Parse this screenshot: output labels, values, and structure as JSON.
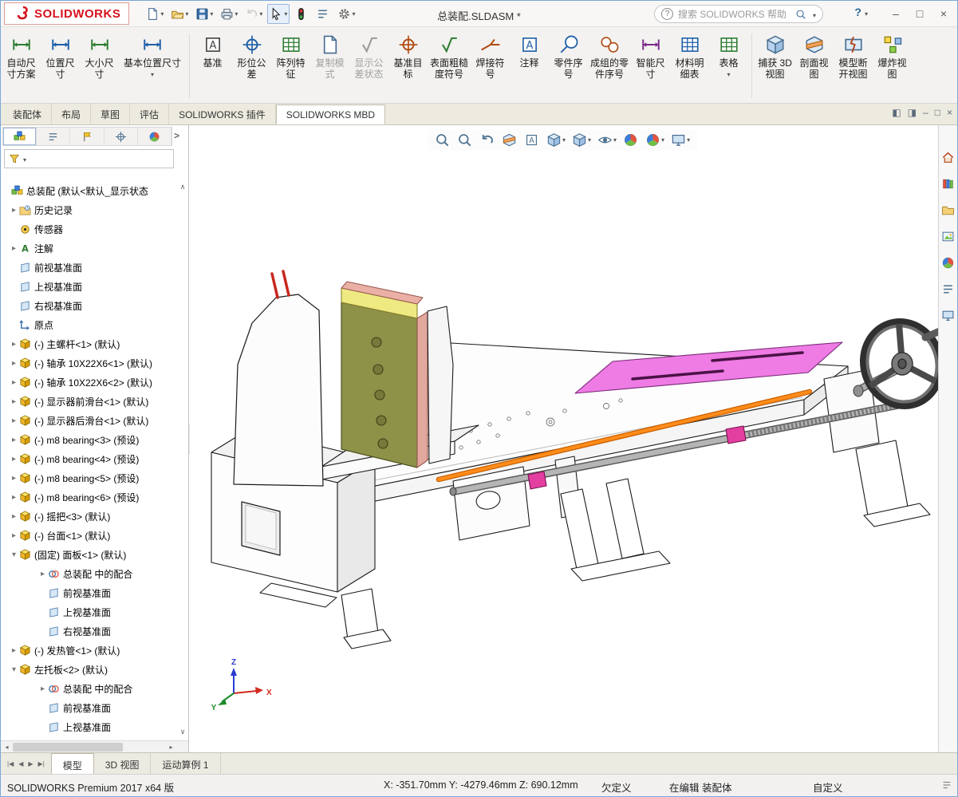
{
  "titlebar": {
    "logo_text": "SOLIDWORKS",
    "document_title": "总装配.SLDASM *",
    "search_placeholder": "搜索 SOLIDWORKS 帮助",
    "help_label": "?",
    "quick_access": [
      {
        "icon": "new-document",
        "dd": "arrow-down"
      },
      {
        "icon": "open",
        "dd": "arrow-down"
      },
      {
        "icon": "save",
        "dd": "arrow-down"
      },
      {
        "icon": "print",
        "dd": "arrow-down"
      },
      {
        "icon": "undo",
        "dd": "arrow-down",
        "disabled": true
      },
      {
        "icon": "select",
        "dd": "arrow-down",
        "pressed": true
      },
      {
        "icon": "rebuild"
      },
      {
        "icon": "file-properties"
      },
      {
        "icon": "options",
        "dd": "arrow-down"
      }
    ],
    "window_controls": [
      {
        "icon": "minimize"
      },
      {
        "icon": "maximize"
      },
      {
        "icon": "close"
      }
    ]
  },
  "ribbon": {
    "items": [
      {
        "icon": "auto-dimension-scheme",
        "label": "自动尺\n寸方案"
      },
      {
        "icon": "location-dimension",
        "label": "位置尺\n寸"
      },
      {
        "icon": "size-dimension",
        "label": "大小尺\n寸"
      },
      {
        "icon": "basic-location-dimension",
        "label": "基本位置尺寸",
        "dd": "arrow-down",
        "wide": true
      },
      {
        "sep": true
      },
      {
        "icon": "datum",
        "label": "基准"
      },
      {
        "icon": "geometric-tolerance",
        "label": "形位公\n差"
      },
      {
        "icon": "pattern-feature",
        "label": "阵列特\n征"
      },
      {
        "icon": "copy-scheme",
        "label": "复制模\n式",
        "disabled": true
      },
      {
        "icon": "tolerance-status",
        "label": "显示公\n差状态",
        "disabled": true
      },
      {
        "icon": "datum-target",
        "label": "基准目\n标"
      },
      {
        "icon": "surface-finish",
        "label": "表面粗糙\n度符号"
      },
      {
        "icon": "weld-symbol",
        "label": "焊接符\n号"
      },
      {
        "icon": "note",
        "label": "注释"
      },
      {
        "icon": "balloon",
        "label": "零件序\n号"
      },
      {
        "icon": "group-balloon",
        "label": "成组的零\n件序号"
      },
      {
        "icon": "smart-dimension",
        "label": "智能尺\n寸"
      },
      {
        "icon": "bom",
        "label": "材料明\n细表"
      },
      {
        "icon": "table",
        "label": "表格",
        "dd": "arrow-down"
      },
      {
        "sep": true
      },
      {
        "icon": "capture-3d-view",
        "label": "捕获 3D\n视图"
      },
      {
        "icon": "section-view",
        "label": "剖面视\n图"
      },
      {
        "icon": "model-break-view",
        "label": "模型断\n开视图"
      },
      {
        "icon": "exploded-view",
        "label": "爆炸视\n图"
      }
    ]
  },
  "cmdtabs": {
    "tabs": [
      {
        "label": "装配体"
      },
      {
        "label": "布局"
      },
      {
        "label": "草图"
      },
      {
        "label": "评估"
      },
      {
        "label": "SOLIDWORKS 插件"
      },
      {
        "label": "SOLIDWORKS MBD",
        "active": true
      }
    ],
    "controls": [
      {
        "icon": "prev-pane"
      },
      {
        "icon": "next-pane"
      },
      {
        "icon": "minimize"
      },
      {
        "icon": "restore"
      },
      {
        "icon": "close"
      }
    ]
  },
  "fmpanel": {
    "tabs": [
      {
        "icon": "featuremanager",
        "active": true
      },
      {
        "icon": "propertymanager"
      },
      {
        "icon": "configurationmanager"
      },
      {
        "icon": "dimxpertmanager"
      },
      {
        "icon": "displaymanager"
      }
    ],
    "tree": [
      {
        "pad": "0px",
        "icon": "assembly",
        "label": "总装配 (默认<默认_显示状态"
      },
      {
        "pad": "10px",
        "arrow": "arrow-right",
        "icon": "history-folder",
        "label": "历史记录"
      },
      {
        "pad": "10px",
        "icon": "sensor",
        "label": "传感器"
      },
      {
        "pad": "10px",
        "arrow": "arrow-right",
        "icon": "annotations",
        "label": "注解"
      },
      {
        "pad": "10px",
        "icon": "plane",
        "label": "前视基准面"
      },
      {
        "pad": "10px",
        "icon": "plane",
        "label": "上视基准面"
      },
      {
        "pad": "10px",
        "icon": "plane",
        "label": "右视基准面"
      },
      {
        "pad": "10px",
        "icon": "origin",
        "label": "原点"
      },
      {
        "pad": "10px",
        "arrow": "arrow-right",
        "icon": "part",
        "label": "(-) 主螺杆<1> (默认)"
      },
      {
        "pad": "10px",
        "arrow": "arrow-right",
        "icon": "part",
        "label": "(-) 轴承 10X22X6<1> (默认)"
      },
      {
        "pad": "10px",
        "arrow": "arrow-right",
        "icon": "part",
        "label": "(-) 轴承 10X22X6<2> (默认)"
      },
      {
        "pad": "10px",
        "arrow": "arrow-right",
        "icon": "part",
        "label": "(-) 显示器前滑台<1> (默认)"
      },
      {
        "pad": "10px",
        "arrow": "arrow-right",
        "icon": "part",
        "label": "(-) 显示器后滑台<1> (默认)"
      },
      {
        "pad": "10px",
        "arrow": "arrow-right",
        "icon": "part",
        "label": "(-) m8 bearing<3> (预设)"
      },
      {
        "pad": "10px",
        "arrow": "arrow-right",
        "icon": "part",
        "label": "(-) m8 bearing<4> (预设)"
      },
      {
        "pad": "10px",
        "arrow": "arrow-right",
        "icon": "part",
        "label": "(-) m8 bearing<5> (预设)"
      },
      {
        "pad": "10px",
        "arrow": "arrow-right",
        "icon": "part",
        "label": "(-) m8 bearing<6> (预设)"
      },
      {
        "pad": "10px",
        "arrow": "arrow-right",
        "icon": "part",
        "label": "(-) 摇把<3> (默认)"
      },
      {
        "pad": "10px",
        "arrow": "arrow-right",
        "icon": "part",
        "label": "(-) 台面<1> (默认)"
      },
      {
        "pad": "10px",
        "arrow": "arrow-down",
        "icon": "part",
        "label": "(固定) 面板<1> (默认)"
      },
      {
        "pad": "46px",
        "arrow": "arrow-right",
        "icon": "mates-folder",
        "label": "总装配 中的配合"
      },
      {
        "pad": "46px",
        "icon": "plane",
        "label": "前视基准面"
      },
      {
        "pad": "46px",
        "icon": "plane",
        "label": "上视基准面"
      },
      {
        "pad": "46px",
        "icon": "plane",
        "label": "右视基准面"
      },
      {
        "pad": "10px",
        "arrow": "arrow-right",
        "icon": "part",
        "label": "(-) 发热管<1> (默认)"
      },
      {
        "pad": "10px",
        "arrow": "arrow-down",
        "icon": "part",
        "label": "左托板<2> (默认)"
      },
      {
        "pad": "46px",
        "arrow": "arrow-right",
        "icon": "mates-folder",
        "label": "总装配 中的配合"
      },
      {
        "pad": "46px",
        "icon": "plane",
        "label": "前视基准面"
      },
      {
        "pad": "46px",
        "icon": "plane",
        "label": "上视基准面"
      }
    ]
  },
  "viewport": {
    "hud": [
      {
        "icon": "zoom-fit"
      },
      {
        "icon": "zoom-area"
      },
      {
        "icon": "previous-view"
      },
      {
        "icon": "section-view-hud"
      },
      {
        "icon": "dynamic-annotation-views"
      },
      {
        "icon": "view-orientation",
        "dd": "arrow-down"
      },
      {
        "icon": "display-style",
        "dd": "arrow-down"
      },
      {
        "icon": "hide-show-items",
        "dd": "arrow-down"
      },
      {
        "icon": "edit-appearance"
      },
      {
        "icon": "apply-scene",
        "dd": "arrow-down"
      },
      {
        "icon": "view-settings",
        "dd": "arrow-down"
      }
    ],
    "triad": {
      "x": "X",
      "y": "Y",
      "z": "Z"
    },
    "model_colors": {
      "lead_screw_highlight": "#ff7f00",
      "slide_plate_pink": "#ef7be4",
      "column_plate_olive": "#8e9148",
      "column_top_yellow": "#efe982",
      "handwheel_gray": "#3c3c3c",
      "heater_red": "#c8281e"
    }
  },
  "taskpane": {
    "items": [
      {
        "icon": "solidworks-resources"
      },
      {
        "icon": "design-library"
      },
      {
        "icon": "file-explorer"
      },
      {
        "icon": "view-palette"
      },
      {
        "icon": "appearances-scenes"
      },
      {
        "icon": "custom-properties"
      },
      {
        "icon": "solidworks-forum"
      }
    ]
  },
  "bottombar": {
    "nav": [
      {
        "icon": "first"
      },
      {
        "icon": "prev"
      },
      {
        "icon": "next"
      },
      {
        "icon": "last"
      }
    ],
    "tabs": [
      {
        "label": "模型",
        "active": true
      },
      {
        "label": "3D 视图"
      },
      {
        "label": "运动算例 1"
      }
    ]
  },
  "statusbar": {
    "product": "SOLIDWORKS Premium 2017 x64 版",
    "coordinates": "X: -351.70mm Y: -4279.46mm Z: 690.12mm",
    "constraint_status": "欠定义",
    "editing": "在编辑 装配体",
    "custom": "自定义"
  }
}
